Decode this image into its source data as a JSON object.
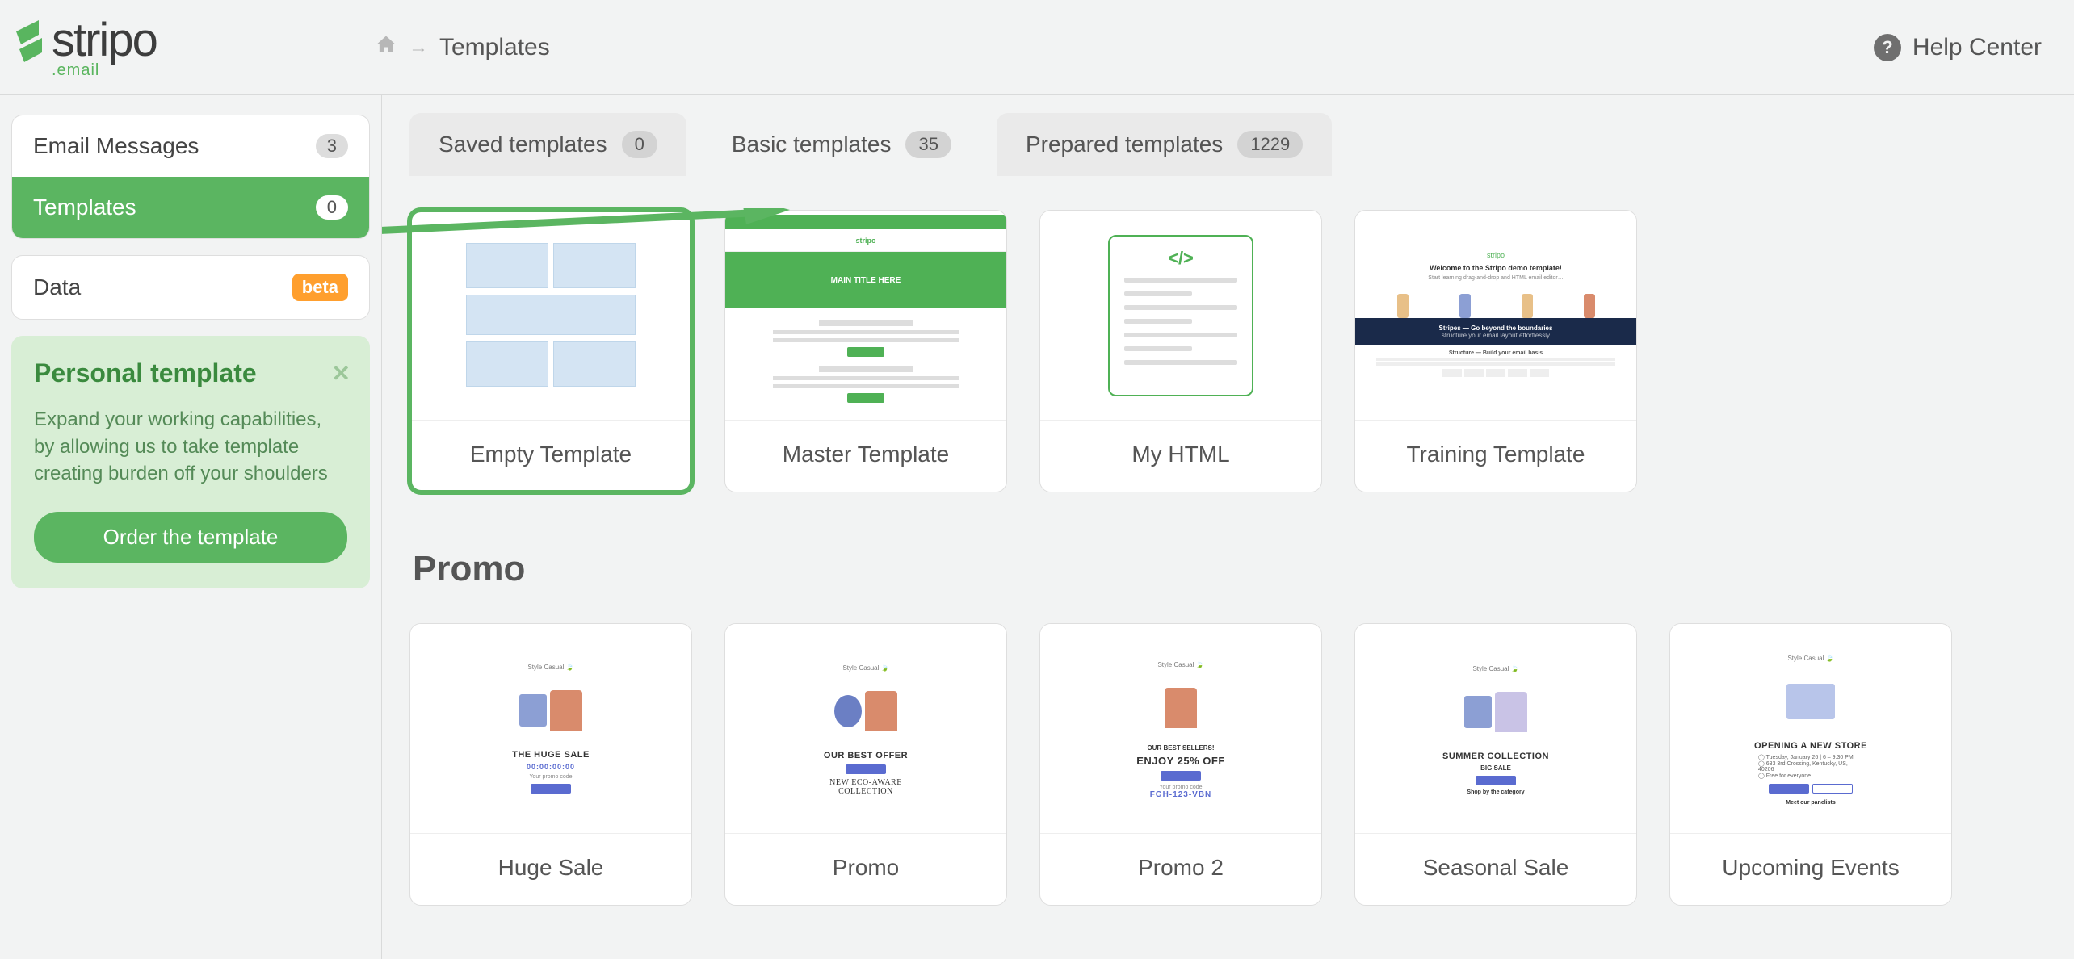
{
  "brand": {
    "name": "stripo",
    "sub": ".email"
  },
  "breadcrumb": {
    "current": "Templates"
  },
  "help": {
    "label": "Help Center"
  },
  "sidebar": {
    "items": [
      {
        "label": "Email Messages",
        "count": "3"
      },
      {
        "label": "Templates",
        "count": "0"
      }
    ],
    "data": {
      "label": "Data",
      "badge": "beta"
    }
  },
  "promo_card": {
    "title": "Personal template",
    "body": "Expand your working capabilities, by allowing us to take template creating burden off your shoulders",
    "cta": "Order the template"
  },
  "tabs": [
    {
      "label": "Saved templates",
      "count": "0"
    },
    {
      "label": "Basic templates",
      "count": "35"
    },
    {
      "label": "Prepared templates",
      "count": "1229"
    }
  ],
  "basic_templates": [
    {
      "label": "Empty Template"
    },
    {
      "label": "Master Template"
    },
    {
      "label": "My HTML"
    },
    {
      "label": "Training Template"
    }
  ],
  "section_promo_title": "Promo",
  "promo_templates": [
    {
      "label": "Huge Sale"
    },
    {
      "label": "Promo"
    },
    {
      "label": "Promo 2"
    },
    {
      "label": "Seasonal Sale"
    },
    {
      "label": "Upcoming Events"
    }
  ],
  "preview_text": {
    "master_hero": "MAIN TITLE HERE",
    "html_icon": "</>",
    "train": {
      "logo": "stripo",
      "title": "Welcome to the Stripo demo template!",
      "band_title": "Stripes — Go beyond the boundaries",
      "foot_title": "Structure — Build your email basis"
    },
    "promo_brand": "Style Casual 🍃",
    "p1": {
      "head": "THE HUGE SALE",
      "sub": "00:00:00:00",
      "mini": "Your promo code"
    },
    "p2": {
      "head": "OUR BEST OFFER",
      "eco1": "NEW ECO-AWARE",
      "eco2": "COLLECTION"
    },
    "p3": {
      "head1": "OUR BEST SELLERS!",
      "head2": "ENJOY 25% OFF",
      "mini": "Your promo code",
      "code": "FGH-123-VBN"
    },
    "p4": {
      "head": "SUMMER COLLECTION",
      "sub": "BIG SALE",
      "mini": "Shop by the category"
    },
    "p5": {
      "head": "OPENING A NEW STORE"
    }
  }
}
